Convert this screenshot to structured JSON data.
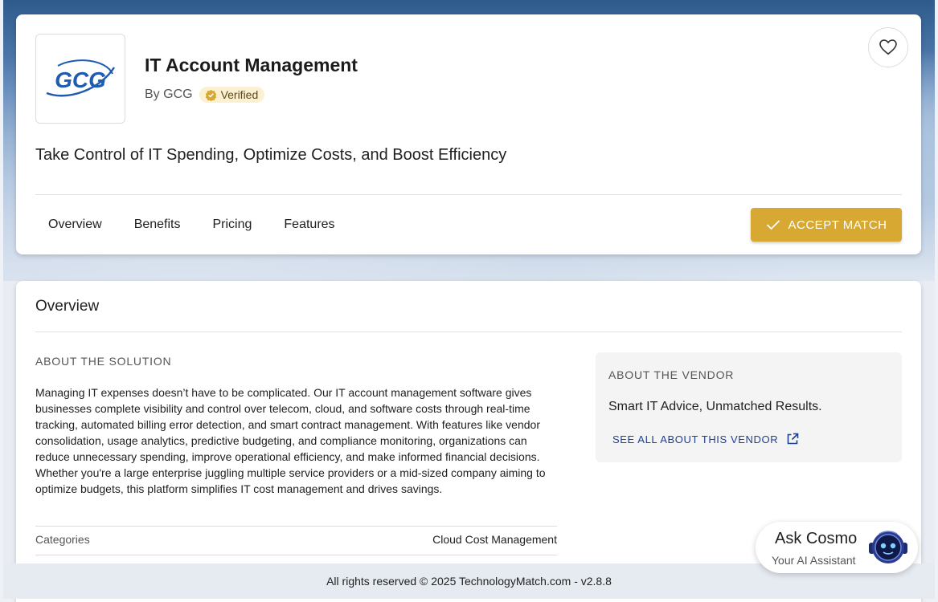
{
  "product": {
    "title": "IT Account Management",
    "by_label": "By GCG",
    "verified_label": "Verified",
    "logo_text": "GCG",
    "tagline": "Take Control of IT Spending, Optimize Costs, and Boost Efficiency"
  },
  "tabs": [
    {
      "label": "Overview"
    },
    {
      "label": "Benefits"
    },
    {
      "label": "Pricing"
    },
    {
      "label": "Features"
    }
  ],
  "accept_button": {
    "label": "ACCEPT MATCH",
    "icon": "check-icon"
  },
  "favorite_button": {
    "icon": "heart-icon"
  },
  "overview": {
    "title": "Overview",
    "about_solution_label": "ABOUT THE SOLUTION",
    "about_solution_text": "Managing IT expenses doesn’t have to be complicated. Our IT account management software gives businesses complete visibility and control over telecom, cloud, and software costs through real-time tracking, automated billing error detection, and smart contract management. With features like vendor consolidation, usage analytics, predictive budgeting, and compliance monitoring, organizations can reduce unnecessary spending, improve operational efficiency, and make informed financial decisions. Whether you're a large enterprise juggling multiple service providers or a mid-sized company aiming to optimize budgets, this platform simplifies IT cost management and drives savings.",
    "categories_label": "Categories",
    "categories_value": "Cloud Cost Management"
  },
  "vendor": {
    "label": "ABOUT THE VENDOR",
    "tagline": "Smart IT Advice, Unmatched Results.",
    "link_label": "SEE ALL ABOUT THIS VENDOR",
    "link_icon": "external-link-icon"
  },
  "cosmo": {
    "title": "Ask Cosmo",
    "subtitle": "Your AI Assistant"
  },
  "footer": {
    "text": "All rights reserved © 2025 TechnologyMatch.com - v2.8.8"
  },
  "colors": {
    "accent_gold": "#d7a832",
    "link_blue": "#1f3f8f",
    "logo_blue": "#1f5bb0"
  }
}
